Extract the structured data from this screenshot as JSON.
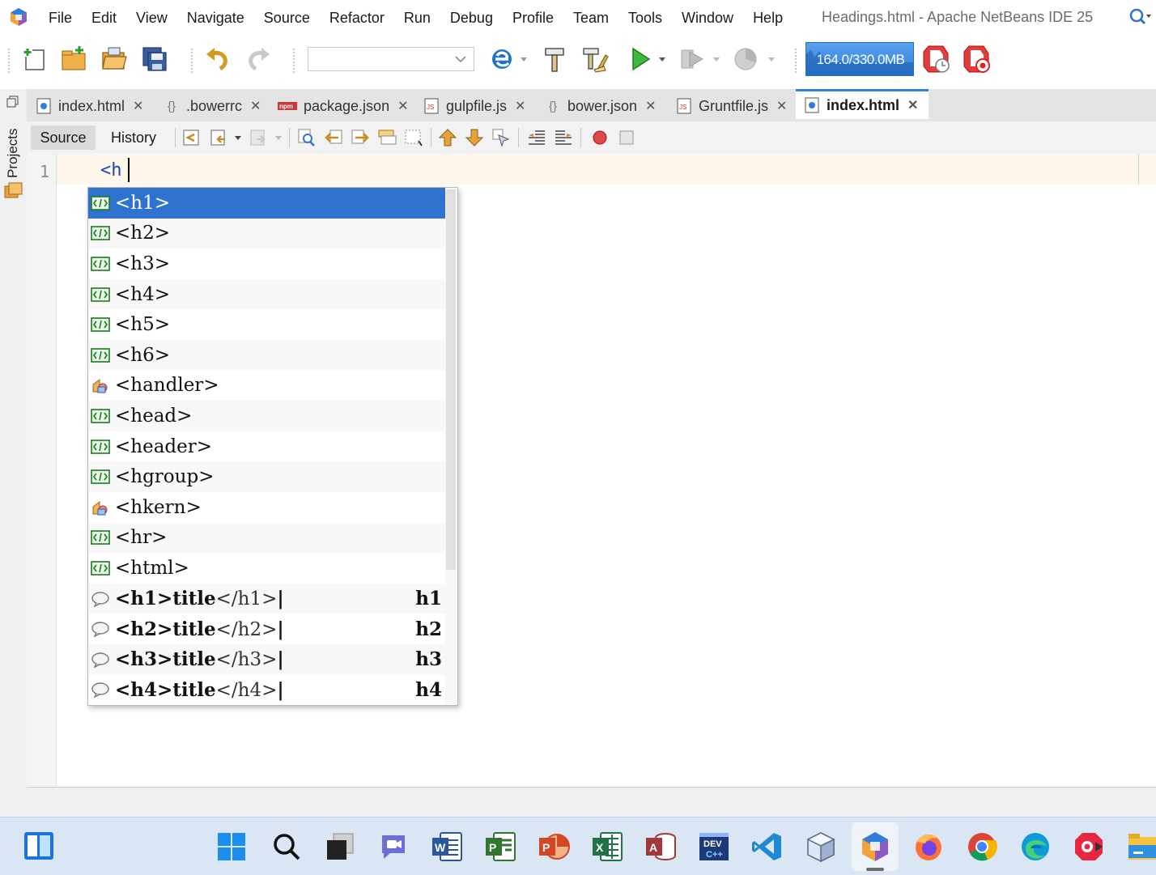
{
  "window_title": "Headings.html - Apache NetBeans IDE 25",
  "menu": [
    "File",
    "Edit",
    "View",
    "Navigate",
    "Source",
    "Refactor",
    "Run",
    "Debug",
    "Profile",
    "Team",
    "Tools",
    "Window",
    "Help"
  ],
  "toolbar": {
    "config_select_value": "",
    "memory_label": "164.0/330.0MB"
  },
  "left_panel": {
    "projects_label": "Projects"
  },
  "tabs": [
    {
      "label": "index.html",
      "icon": "html-file-icon",
      "active": false
    },
    {
      "label": ".bowerrc",
      "icon": "json-braces-icon",
      "active": false
    },
    {
      "label": "package.json",
      "icon": "npm-icon",
      "active": false
    },
    {
      "label": "gulpfile.js",
      "icon": "js-file-icon",
      "active": false
    },
    {
      "label": "bower.json",
      "icon": "json-braces-icon",
      "active": false
    },
    {
      "label": "Gruntfile.js",
      "icon": "js-file-icon",
      "active": false
    },
    {
      "label": "index.html",
      "icon": "html-file-icon",
      "active": true
    }
  ],
  "editor_toolbar": {
    "source_label": "Source",
    "history_label": "History"
  },
  "editor": {
    "line_number": "1",
    "code": "<h"
  },
  "completion": {
    "items": [
      {
        "text": "<h1>",
        "kind": "html-tag",
        "abbr": "",
        "selected": true
      },
      {
        "text": "<h2>",
        "kind": "html-tag",
        "abbr": ""
      },
      {
        "text": "<h3>",
        "kind": "html-tag",
        "abbr": ""
      },
      {
        "text": "<h4>",
        "kind": "html-tag",
        "abbr": ""
      },
      {
        "text": "<h5>",
        "kind": "html-tag",
        "abbr": ""
      },
      {
        "text": "<h6>",
        "kind": "html-tag",
        "abbr": ""
      },
      {
        "text": "<handler>",
        "kind": "svg-tag",
        "abbr": ""
      },
      {
        "text": "<head>",
        "kind": "html-tag",
        "abbr": ""
      },
      {
        "text": "<header>",
        "kind": "html-tag",
        "abbr": ""
      },
      {
        "text": "<hgroup>",
        "kind": "html-tag",
        "abbr": ""
      },
      {
        "text": "<hkern>",
        "kind": "svg-tag",
        "abbr": ""
      },
      {
        "text": "<hr>",
        "kind": "html-tag",
        "abbr": ""
      },
      {
        "text": "<html>",
        "kind": "html-tag",
        "abbr": ""
      },
      {
        "text": "<h1>title</h1>|",
        "bold": "<h1>title",
        "dim": "</h1>",
        "tail": "|",
        "kind": "template",
        "abbr": "h1"
      },
      {
        "text": "<h2>title</h2>|",
        "bold": "<h2>title",
        "dim": "</h2>",
        "tail": "|",
        "kind": "template",
        "abbr": "h2"
      },
      {
        "text": "<h3>title</h3>|",
        "bold": "<h3>title",
        "dim": "</h3>",
        "tail": "|",
        "kind": "template",
        "abbr": "h3"
      },
      {
        "text": "<h4>title</h4>|",
        "bold": "<h4>title",
        "dim": "</h4>",
        "tail": "|",
        "kind": "template",
        "abbr": "h4"
      }
    ]
  },
  "taskbar": {
    "apps": [
      "widgets",
      "start",
      "search",
      "task-view",
      "teams",
      "word",
      "project",
      "powerpoint",
      "excel",
      "access",
      "devcpp",
      "vscode",
      "virtualbox",
      "netbeans",
      "firefox",
      "chrome",
      "edge",
      "screen-recorder",
      "file-explorer"
    ]
  },
  "colors": {
    "accent": "#2d83d6",
    "selection": "#2f72cf",
    "current_line": "#fdf6ea",
    "taskbar": "#dbe6f5"
  }
}
